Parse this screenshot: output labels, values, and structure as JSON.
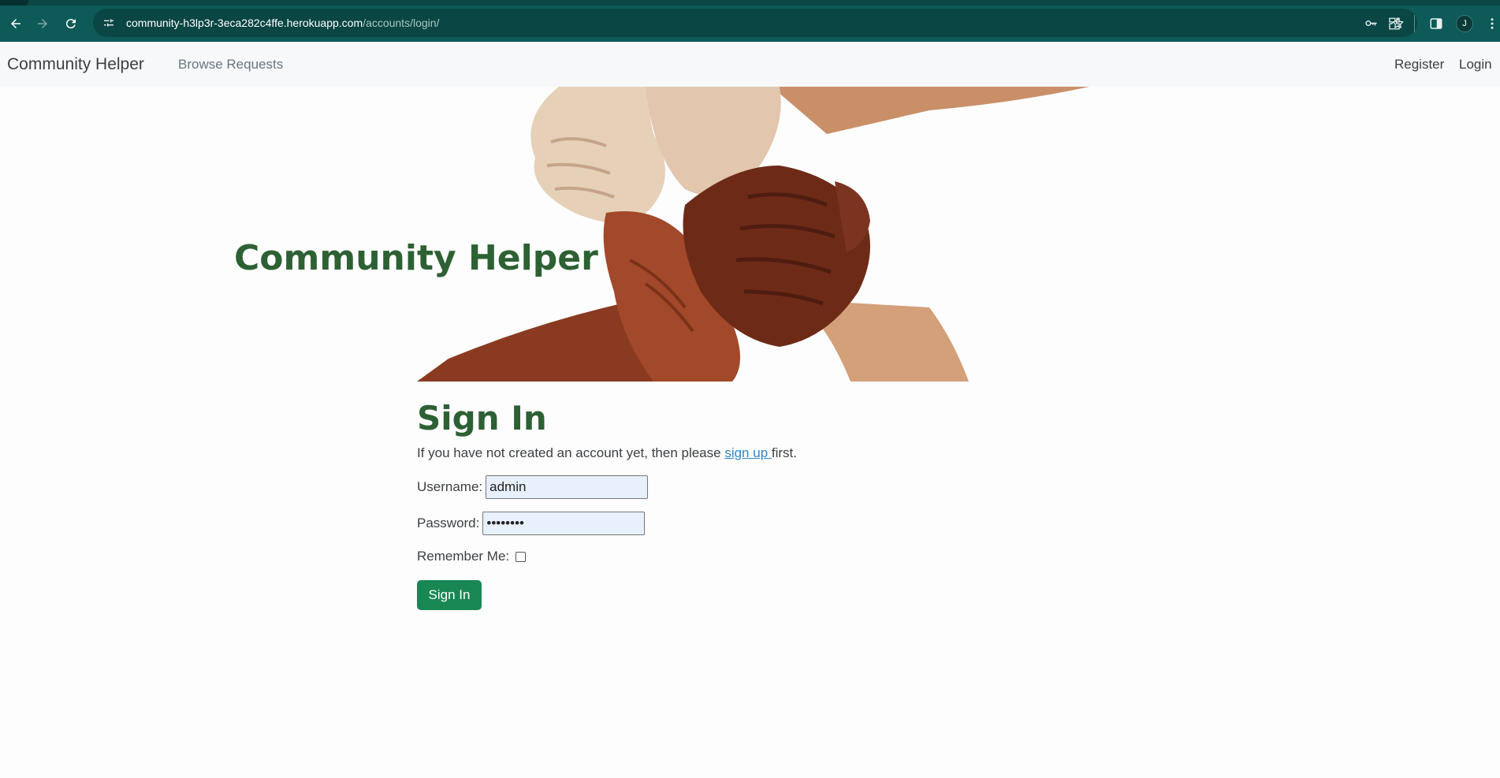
{
  "browser": {
    "url_host": "community-h3lp3r-3eca282c4ffe.herokuapp.com",
    "url_path": "/accounts/login/",
    "profile_initial": "J"
  },
  "navbar": {
    "brand": "Community Helper",
    "browse_link": "Browse Requests",
    "register_link": "Register",
    "login_link": "Login"
  },
  "hero": {
    "title": "Community Helper"
  },
  "signin": {
    "heading": "Sign In",
    "intro_before": "If you have not created an account yet, then please ",
    "intro_link": "sign up ",
    "intro_after": "first.",
    "username_label": "Username:",
    "username_value": "admin",
    "password_label": "Password:",
    "password_value": "••••••••",
    "remember_label": "Remember Me:",
    "remember_checked": false,
    "submit_label": "Sign In"
  },
  "colors": {
    "browser_chrome": "#0d5a58",
    "heading_green": "#2d6134",
    "button_green": "#198754",
    "link_blue": "#2f86c8",
    "autofill_bg": "#e8f0fe"
  },
  "icons": {
    "back": "arrow-left-icon",
    "forward": "arrow-right-icon",
    "reload": "reload-icon",
    "site_info": "tune-icon",
    "password_key": "key-icon",
    "bookmark": "star-icon",
    "extensions": "puzzle-icon",
    "side_panel": "side-panel-icon",
    "menu": "kebab-menu-icon"
  }
}
